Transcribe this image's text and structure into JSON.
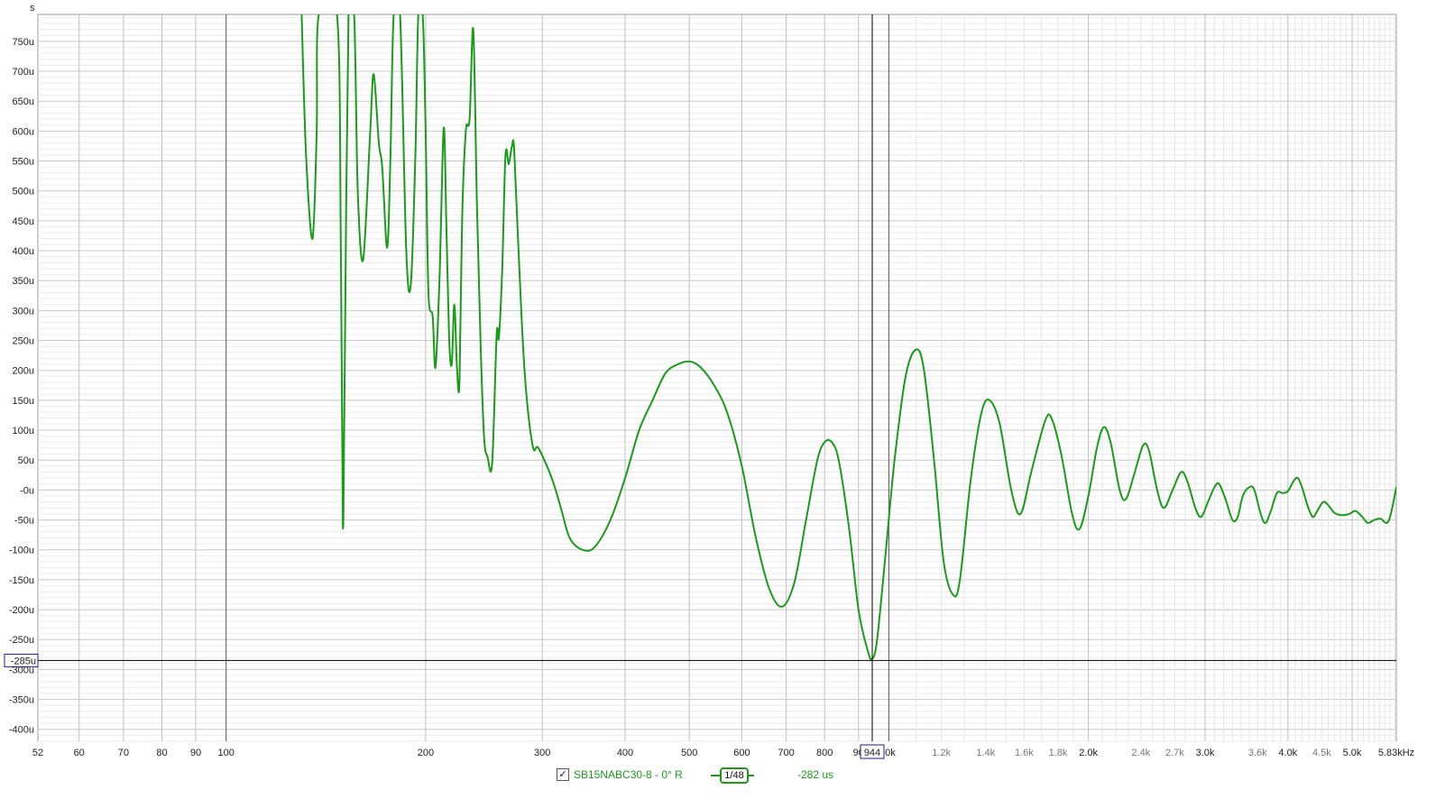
{
  "y_unit_label": "s",
  "cursor": {
    "freq_label": "944",
    "value_label": "-285u",
    "freq": 944,
    "value": -285
  },
  "legend": {
    "checkbox_mark": "✓",
    "trace_name": "SB15NABC30-8 - 0° R",
    "smoothing_label": "1/48",
    "readout": "-282 us",
    "trace_color": "#1a9c1a"
  },
  "chart_data": {
    "type": "line",
    "title": "",
    "xlabel": "",
    "ylabel": "s",
    "x_scale": "log",
    "xlim": [
      52,
      5830
    ],
    "ylim": [
      -420,
      795
    ],
    "grid": true,
    "y_ticks": [
      750,
      700,
      650,
      600,
      550,
      500,
      450,
      400,
      350,
      300,
      250,
      200,
      150,
      100,
      50,
      0,
      -50,
      -100,
      -150,
      -200,
      -250,
      -300,
      -350,
      -400
    ],
    "y_tick_labels": [
      "750u",
      "700u",
      "650u",
      "600u",
      "550u",
      "500u",
      "450u",
      "400u",
      "350u",
      "300u",
      "250u",
      "200u",
      "150u",
      "100u",
      "50u",
      "-0u",
      "-50u",
      "-100u",
      "-150u",
      "-200u",
      "-250u",
      "-300u",
      "-350u",
      "-400u"
    ],
    "x_ticks": [
      {
        "f": 52,
        "label": "52",
        "major": true
      },
      {
        "f": 60,
        "label": "60",
        "major": true
      },
      {
        "f": 70,
        "label": "70",
        "major": true
      },
      {
        "f": 80,
        "label": "80",
        "major": true
      },
      {
        "f": 90,
        "label": "90",
        "major": true
      },
      {
        "f": 100,
        "label": "100",
        "major": true
      },
      {
        "f": 200,
        "label": "200",
        "major": true
      },
      {
        "f": 300,
        "label": "300",
        "major": true
      },
      {
        "f": 400,
        "label": "400",
        "major": true
      },
      {
        "f": 500,
        "label": "500",
        "major": true
      },
      {
        "f": 600,
        "label": "600",
        "major": true
      },
      {
        "f": 700,
        "label": "700",
        "major": true
      },
      {
        "f": 800,
        "label": "800",
        "major": true
      },
      {
        "f": 900,
        "label": "90",
        "major": true
      },
      {
        "f": 1000,
        "label": ".0k",
        "major": true
      },
      {
        "f": 1200,
        "label": "1.2k",
        "major": false
      },
      {
        "f": 1400,
        "label": "1.4k",
        "major": false
      },
      {
        "f": 1600,
        "label": "1.6k",
        "major": false
      },
      {
        "f": 1800,
        "label": "1.8k",
        "major": false
      },
      {
        "f": 2000,
        "label": "2.0k",
        "major": true
      },
      {
        "f": 2400,
        "label": "2.4k",
        "major": false
      },
      {
        "f": 2700,
        "label": "2.7k",
        "major": false
      },
      {
        "f": 3000,
        "label": "3.0k",
        "major": true
      },
      {
        "f": 3600,
        "label": "3.6k",
        "major": false
      },
      {
        "f": 4000,
        "label": "4.0k",
        "major": true
      },
      {
        "f": 4500,
        "label": "4.5k",
        "major": false
      },
      {
        "f": 5000,
        "label": "5.0k",
        "major": true
      },
      {
        "f": 5830,
        "label": "5.83kHz",
        "major": true
      }
    ],
    "series": [
      {
        "color": "#1a9c1a",
        "points": [
          [
            130,
            795
          ],
          [
            132,
            560
          ],
          [
            135,
            420
          ],
          [
            137,
            600
          ],
          [
            138,
            795
          ],
          [
            147,
            795
          ],
          [
            149,
            400
          ],
          [
            150,
            -60
          ],
          [
            151,
            200
          ],
          [
            153,
            795
          ],
          [
            156,
            795
          ],
          [
            158,
            500
          ],
          [
            161,
            385
          ],
          [
            165,
            600
          ],
          [
            167,
            695
          ],
          [
            170,
            580
          ],
          [
            172,
            540
          ],
          [
            175,
            405
          ],
          [
            177,
            560
          ],
          [
            179,
            795
          ],
          [
            183,
            795
          ],
          [
            187,
            400
          ],
          [
            190,
            345
          ],
          [
            193,
            560
          ],
          [
            195,
            795
          ],
          [
            198,
            795
          ],
          [
            200,
            600
          ],
          [
            202,
            330
          ],
          [
            205,
            290
          ],
          [
            207,
            205
          ],
          [
            210,
            360
          ],
          [
            213,
            605
          ],
          [
            215,
            440
          ],
          [
            217,
            255
          ],
          [
            219,
            210
          ],
          [
            221,
            310
          ],
          [
            223,
            205
          ],
          [
            225,
            180
          ],
          [
            227,
            450
          ],
          [
            230,
            600
          ],
          [
            233,
            620
          ],
          [
            236,
            770
          ],
          [
            239,
            480
          ],
          [
            242,
            250
          ],
          [
            245,
            90
          ],
          [
            248,
            55
          ],
          [
            252,
            45
          ],
          [
            256,
            260
          ],
          [
            258,
            255
          ],
          [
            261,
            370
          ],
          [
            264,
            560
          ],
          [
            267,
            545
          ],
          [
            270,
            575
          ],
          [
            272,
            570
          ],
          [
            276,
            410
          ],
          [
            282,
            200
          ],
          [
            290,
            75
          ],
          [
            296,
            70
          ],
          [
            310,
            20
          ],
          [
            320,
            -30
          ],
          [
            330,
            -80
          ],
          [
            345,
            -100
          ],
          [
            360,
            -95
          ],
          [
            380,
            -50
          ],
          [
            400,
            20
          ],
          [
            420,
            100
          ],
          [
            440,
            150
          ],
          [
            460,
            195
          ],
          [
            480,
            210
          ],
          [
            500,
            215
          ],
          [
            520,
            205
          ],
          [
            545,
            175
          ],
          [
            570,
            130
          ],
          [
            600,
            40
          ],
          [
            630,
            -80
          ],
          [
            660,
            -165
          ],
          [
            690,
            -195
          ],
          [
            720,
            -155
          ],
          [
            750,
            -50
          ],
          [
            780,
            50
          ],
          [
            800,
            80
          ],
          [
            820,
            80
          ],
          [
            840,
            50
          ],
          [
            870,
            -60
          ],
          [
            900,
            -200
          ],
          [
            930,
            -270
          ],
          [
            944,
            -282
          ],
          [
            960,
            -250
          ],
          [
            990,
            -100
          ],
          [
            1020,
            50
          ],
          [
            1060,
            190
          ],
          [
            1100,
            235
          ],
          [
            1130,
            200
          ],
          [
            1170,
            50
          ],
          [
            1210,
            -120
          ],
          [
            1250,
            -175
          ],
          [
            1280,
            -150
          ],
          [
            1330,
            20
          ],
          [
            1380,
            130
          ],
          [
            1420,
            150
          ],
          [
            1470,
            110
          ],
          [
            1530,
            0
          ],
          [
            1580,
            -40
          ],
          [
            1640,
            30
          ],
          [
            1720,
            115
          ],
          [
            1760,
            120
          ],
          [
            1820,
            60
          ],
          [
            1890,
            -40
          ],
          [
            1940,
            -65
          ],
          [
            2000,
            -10
          ],
          [
            2060,
            70
          ],
          [
            2110,
            105
          ],
          [
            2160,
            80
          ],
          [
            2230,
            0
          ],
          [
            2280,
            -15
          ],
          [
            2350,
            30
          ],
          [
            2420,
            75
          ],
          [
            2470,
            65
          ],
          [
            2540,
            0
          ],
          [
            2600,
            -30
          ],
          [
            2680,
            0
          ],
          [
            2760,
            30
          ],
          [
            2820,
            15
          ],
          [
            2900,
            -30
          ],
          [
            2960,
            -45
          ],
          [
            3030,
            -20
          ],
          [
            3100,
            5
          ],
          [
            3150,
            10
          ],
          [
            3220,
            -15
          ],
          [
            3300,
            -50
          ],
          [
            3360,
            -45
          ],
          [
            3420,
            -10
          ],
          [
            3500,
            5
          ],
          [
            3560,
            0
          ],
          [
            3640,
            -40
          ],
          [
            3700,
            -55
          ],
          [
            3770,
            -35
          ],
          [
            3850,
            -5
          ],
          [
            3930,
            -5
          ],
          [
            4000,
            -2
          ],
          [
            4080,
            15
          ],
          [
            4140,
            20
          ],
          [
            4200,
            5
          ],
          [
            4280,
            -25
          ],
          [
            4360,
            -45
          ],
          [
            4430,
            -35
          ],
          [
            4520,
            -20
          ],
          [
            4600,
            -25
          ],
          [
            4700,
            -38
          ],
          [
            4820,
            -42
          ],
          [
            4950,
            -40
          ],
          [
            5060,
            -35
          ],
          [
            5180,
            -45
          ],
          [
            5280,
            -55
          ],
          [
            5400,
            -50
          ],
          [
            5520,
            -48
          ],
          [
            5640,
            -55
          ],
          [
            5720,
            -40
          ],
          [
            5830,
            5
          ]
        ]
      }
    ]
  }
}
